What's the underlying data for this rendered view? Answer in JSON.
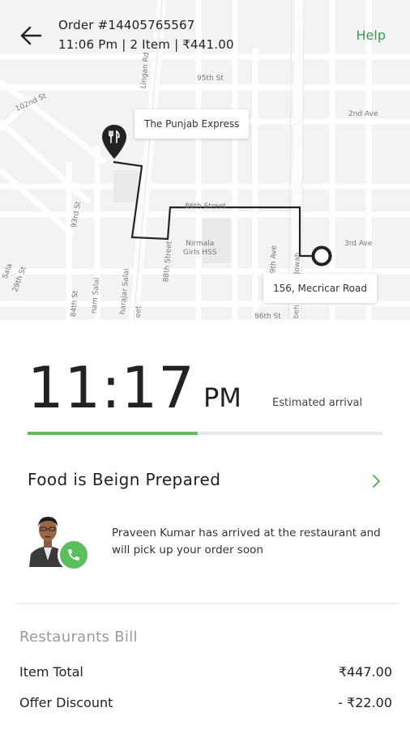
{
  "header": {
    "order_id": "Order #14405765567",
    "order_meta": "11:06 Pm | 2 Item | ₹441.00",
    "help_label": "Help"
  },
  "map": {
    "restaurant_label": "The Punjab Express",
    "destination_label": "156, Mecricar Road",
    "street_labels": {
      "s95th": "95th St",
      "s102nd": "102nd St",
      "s2nd": "2nd Ave",
      "s3rd": "3rd Ave",
      "s93rd": "93rd St",
      "s88th": "88th Street",
      "s86th": "86th Street",
      "s19th": "19th Ave",
      "s84th": "84th St",
      "s86th_st": "86th St",
      "s29th": "29th St",
      "linganrd": "Lingan Rd",
      "nirmala": "Nirmala\nGirls HSS",
      "tharajar": "harajar Salai",
      "nam": "nam Salai",
      "jowah": "Jowah",
      "sala": "Sala",
      "beh": "beh",
      "eet": "eet"
    }
  },
  "eta": {
    "time": "11:17",
    "ampm": "PM",
    "label": "Estimated arrival",
    "progress": 0.48
  },
  "status": {
    "title": "Food is Beign Prepared"
  },
  "driver": {
    "message": "Praveen Kumar has arrived at the restaurant and will pick up your order soon"
  },
  "bill": {
    "title": "Restaurants Bill",
    "rows": [
      {
        "label": "Item Total",
        "amount": "₹447.00"
      },
      {
        "label": "Offer Discount",
        "amount": "- ₹22.00"
      }
    ]
  },
  "colors": {
    "accent_green": "#5cbf5e",
    "help_green": "#3a9b4f"
  }
}
